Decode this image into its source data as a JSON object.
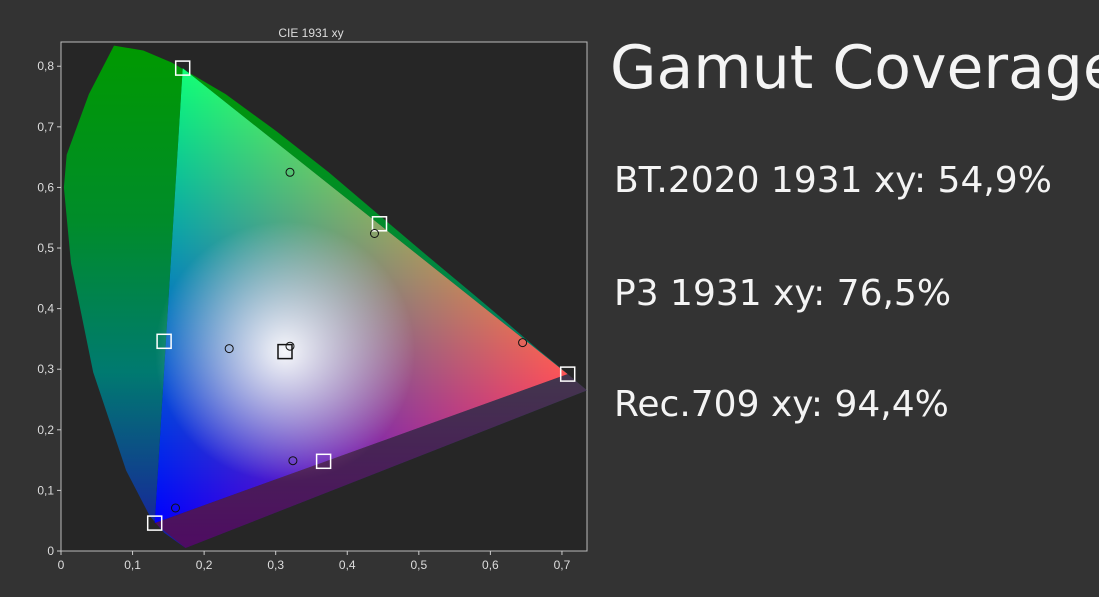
{
  "headline": "Gamut Coverage",
  "stats": [
    {
      "text": "BT.2020 1931 xy: 54,9%"
    },
    {
      "text": "P3 1931 xy: 76,5%"
    },
    {
      "text": "Rec.709 xy: 94,4%"
    }
  ],
  "colors": {
    "page_background": "#333333",
    "plot_background": "#262626",
    "axis": "#cccccc",
    "text": "#ffffff"
  },
  "chart_data": {
    "type": "scatter",
    "title": "CIE 1931 xy",
    "xlabel": "",
    "ylabel": "",
    "xlim": [
      0,
      0.735
    ],
    "ylim": [
      0,
      0.84
    ],
    "x_ticks": [
      "0",
      "0,1",
      "0,2",
      "0,3",
      "0,4",
      "0,5",
      "0,6",
      "0,7"
    ],
    "x_tick_values": [
      0,
      0.1,
      0.2,
      0.3,
      0.4,
      0.5,
      0.6,
      0.7
    ],
    "y_ticks": [
      "0",
      "0,1",
      "0,2",
      "0,3",
      "0,4",
      "0,5",
      "0,6",
      "0,7",
      "0,8"
    ],
    "y_tick_values": [
      0,
      0.1,
      0.2,
      0.3,
      0.4,
      0.5,
      0.6,
      0.7,
      0.8
    ],
    "grid": false,
    "target_squares": [
      {
        "x": 0.17,
        "y": 0.797
      },
      {
        "x": 0.445,
        "y": 0.54
      },
      {
        "x": 0.708,
        "y": 0.292
      },
      {
        "x": 0.367,
        "y": 0.148
      },
      {
        "x": 0.131,
        "y": 0.046
      },
      {
        "x": 0.144,
        "y": 0.346
      },
      {
        "x": 0.313,
        "y": 0.329
      }
    ],
    "measured_circles": [
      {
        "x": 0.32,
        "y": 0.625
      },
      {
        "x": 0.438,
        "y": 0.524
      },
      {
        "x": 0.645,
        "y": 0.344
      },
      {
        "x": 0.324,
        "y": 0.149
      },
      {
        "x": 0.16,
        "y": 0.071
      },
      {
        "x": 0.235,
        "y": 0.334
      },
      {
        "x": 0.32,
        "y": 0.338
      }
    ]
  }
}
